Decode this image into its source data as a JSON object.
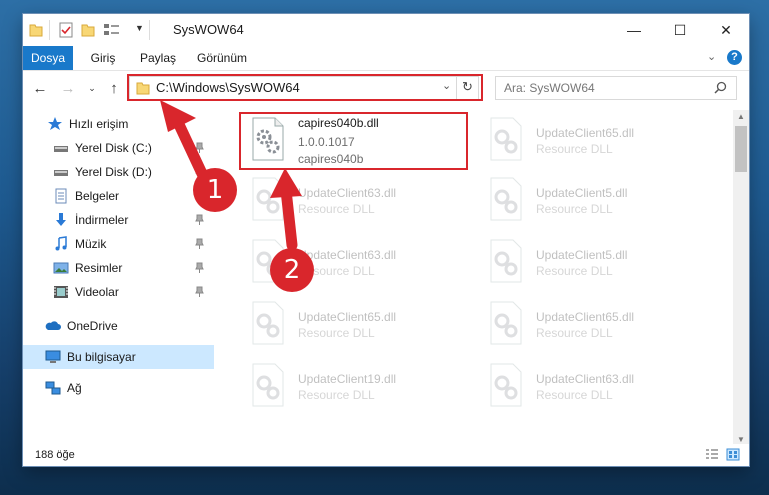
{
  "window": {
    "title": "SysWOW64",
    "min": "—",
    "max": "☐",
    "close": "✕"
  },
  "ribbon": {
    "tabs": [
      "Dosya",
      "Giriş",
      "Paylaş",
      "Görünüm"
    ],
    "collapse_icon": "chevron-down-icon",
    "help": "?"
  },
  "address": {
    "path": "C:\\Windows\\SysWOW64",
    "search_placeholder": "Ara: SysWOW64"
  },
  "sidebar": {
    "items": [
      {
        "label": "Hızlı erişim",
        "icon": "star-icon"
      },
      {
        "label": "Yerel Disk (C:)",
        "icon": "drive-icon",
        "pinned": true
      },
      {
        "label": "Yerel Disk (D:)",
        "icon": "drive-icon",
        "pinned": true
      },
      {
        "label": "Belgeler",
        "icon": "documents-icon",
        "pinned": true
      },
      {
        "label": "İndirmeler",
        "icon": "download-icon",
        "pinned": true
      },
      {
        "label": "Müzik",
        "icon": "music-icon",
        "pinned": true
      },
      {
        "label": "Resimler",
        "icon": "pictures-icon",
        "pinned": true
      },
      {
        "label": "Videolar",
        "icon": "video-icon",
        "pinned": true
      },
      {
        "label": "OneDrive",
        "icon": "cloud-icon"
      },
      {
        "label": "Bu bilgisayar",
        "icon": "computer-icon",
        "selected": true
      },
      {
        "label": "Ağ",
        "icon": "network-icon"
      }
    ]
  },
  "files": {
    "main": {
      "name": "capires040b.dll",
      "version": "1.0.0.1017",
      "description": "capires040b"
    },
    "others": [
      {
        "name": "UpdateClient65.dll",
        "type": "Resource DLL"
      },
      {
        "name": "UpdateClient63.dll",
        "type": "Resource DLL"
      },
      {
        "name": "UpdateClient5.dll",
        "type": "Resource DLL"
      },
      {
        "name": "UpdateClient63.dll",
        "type": "Resource DLL"
      },
      {
        "name": "UpdateClient5.dll",
        "type": "Resource DLL"
      },
      {
        "name": "UpdateClient65.dll",
        "type": "Resource DLL"
      },
      {
        "name": "UpdateClient65.dll",
        "type": "Resource DLL"
      },
      {
        "name": "UpdateClient19.dll",
        "type": "Resource DLL"
      },
      {
        "name": "UpdateClient63.dll",
        "type": "Resource DLL"
      }
    ]
  },
  "status": {
    "count": "188 öğe"
  },
  "annotations": {
    "step1": "1",
    "step2": "2"
  },
  "colors": {
    "accent": "#1979ca",
    "annotation_red": "#d9262c",
    "selection": "#cce8ff"
  }
}
